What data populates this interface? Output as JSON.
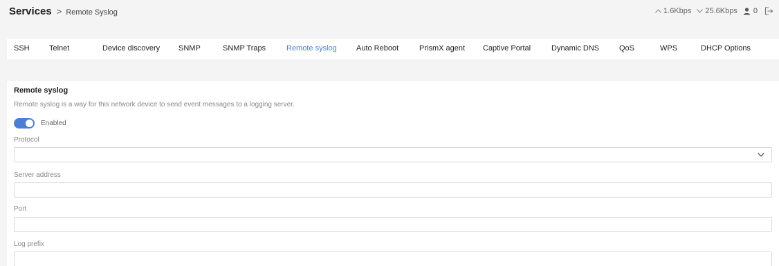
{
  "header": {
    "breadcrumb_root": "Services",
    "breadcrumb_separator": ">",
    "breadcrumb_current": "Remote Syslog",
    "upload_rate": "1.6Kbps",
    "download_rate": "25.6Kbps",
    "user_count": "0"
  },
  "tabs": [
    {
      "label": "SSH",
      "active": false
    },
    {
      "label": "Telnet",
      "active": false
    },
    {
      "label": "Device discovery",
      "active": false
    },
    {
      "label": "SNMP",
      "active": false
    },
    {
      "label": "SNMP Traps",
      "active": false
    },
    {
      "label": "Remote syslog",
      "active": true
    },
    {
      "label": "Auto Reboot",
      "active": false
    },
    {
      "label": "PrismX agent",
      "active": false
    },
    {
      "label": "Captive Portal",
      "active": false
    },
    {
      "label": "Dynamic DNS",
      "active": false
    },
    {
      "label": "QoS",
      "active": false
    },
    {
      "label": "WPS",
      "active": false
    },
    {
      "label": "DHCP Options",
      "active": false
    }
  ],
  "section": {
    "title": "Remote syslog",
    "description": "Remote syslog is a way for this network device to send event messages to a logging server.",
    "enabled_label": "Enabled",
    "enabled": true
  },
  "form": {
    "protocol_label": "Protocol",
    "protocol_value": "",
    "server_label": "Server address",
    "server_value": "",
    "port_label": "Port",
    "port_value": "",
    "prefix_label": "Log prefix",
    "prefix_value": ""
  },
  "colors": {
    "accent": "#4a7fd4",
    "background": "#f4f4f4"
  },
  "icons": [
    "chevron-up-icon",
    "chevron-down-icon",
    "user-icon",
    "logout-icon",
    "select-chevron-icon"
  ]
}
